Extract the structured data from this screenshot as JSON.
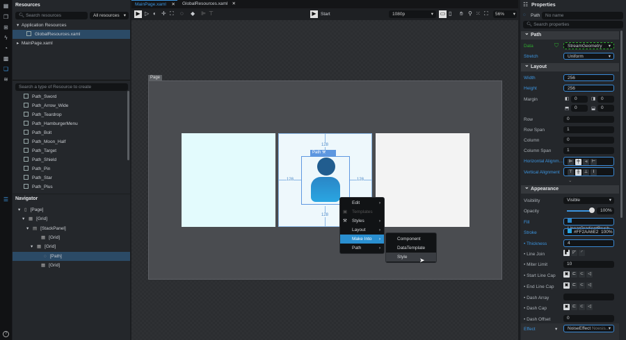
{
  "rail": {
    "icons": [
      "grid-menu-icon",
      "assets-icon",
      "add-box-icon",
      "lightning-icon",
      "palette-icon",
      "media-icon",
      "resources-icon",
      "database-icon",
      "navigator-icon",
      "help-icon"
    ]
  },
  "resources": {
    "title": "Resources",
    "search_placeholder": "Search resources",
    "filter": "All resources",
    "tree": [
      {
        "label": "Application Resources"
      },
      {
        "label": "GlobalResources.xaml"
      },
      {
        "label": "MainPage.xaml"
      }
    ],
    "create_placeholder": "Search a type of Resource to create",
    "types": [
      "Path_Sword",
      "Path_Arrow_Wide",
      "Path_Teardrop",
      "Path_HamburgerMenu",
      "Path_Bolt",
      "Path_Moon_Half",
      "Path_Target",
      "Path_Shield",
      "Path_Pin",
      "Path_Star",
      "Path_Plus"
    ]
  },
  "navigator": {
    "title": "Navigator",
    "items": [
      "[Page]",
      "[Grid]",
      "[StackPanel]",
      "[Grid]",
      "[Grid]",
      "[Path]",
      "[Grid]"
    ]
  },
  "tabs": [
    {
      "label": "MainPage.xaml",
      "active": true
    },
    {
      "label": "GlobalResources.xaml",
      "active": false
    }
  ],
  "toolbar": {
    "start": "Start",
    "resolution": "1080p",
    "zoom": "56%"
  },
  "canvas": {
    "page_label": "Page",
    "selection_label": "Path",
    "margins": [
      "128",
      "128",
      "128",
      "128"
    ]
  },
  "context_menu": {
    "items": [
      "Edit",
      "Templates",
      "Styles",
      "Layout",
      "Make Into",
      "Path"
    ],
    "submenu": [
      "Component",
      "DataTemplate",
      "Style"
    ]
  },
  "properties": {
    "title": "Properties",
    "type": "Path",
    "name_placeholder": "No name",
    "search_placeholder": "Search properties",
    "sections": {
      "path": "Path",
      "layout": "Layout",
      "appearance": "Appearance"
    },
    "data_label": "Data",
    "data_value": "StreamGeometry",
    "stretch_label": "Stretch",
    "stretch_value": "Uniform",
    "width_label": "Width",
    "width": "256",
    "height_label": "Height",
    "height": "256",
    "margin_label": "Margin",
    "margin": [
      "0",
      "0",
      "0",
      "0"
    ],
    "row_label": "Row",
    "row": "0",
    "rowspan_label": "Row Span",
    "rowspan": "1",
    "column_label": "Column",
    "column": "0",
    "colspan_label": "Column Span",
    "colspan": "1",
    "halign_label": "Horizontal Alignm...",
    "valign_label": "Vertical Alignment",
    "visibility_label": "Visibility",
    "visibility": "Visible",
    "opacity_label": "Opacity",
    "opacity": "100%",
    "fill_label": "Fill",
    "fill": "LinearGradientBrush",
    "stroke_label": "Stroke",
    "stroke": "#FF2AA6E2",
    "stroke_opacity": "100%",
    "thickness_label": "• Thickness",
    "thickness": "4",
    "linejoin_label": "• Line Join",
    "miter_label": "• Miter Limit",
    "miter": "10",
    "startcap_label": "• Start Line Cap",
    "endcap_label": "• End Line Cap",
    "dasharray_label": "• Dash Array",
    "dashcap_label": "• Dash Cap",
    "dashoffset_label": "• Dash Offset",
    "dashoffset": "0",
    "effect_label": "Effect",
    "effect": "NoiseEffect",
    "effect_hint": "Noesis..."
  },
  "colors": {
    "accent": "#3c95e0",
    "selection": "#2b4a66",
    "menu_active": "#2a8fd0",
    "stroke": "#2AA6E2"
  }
}
